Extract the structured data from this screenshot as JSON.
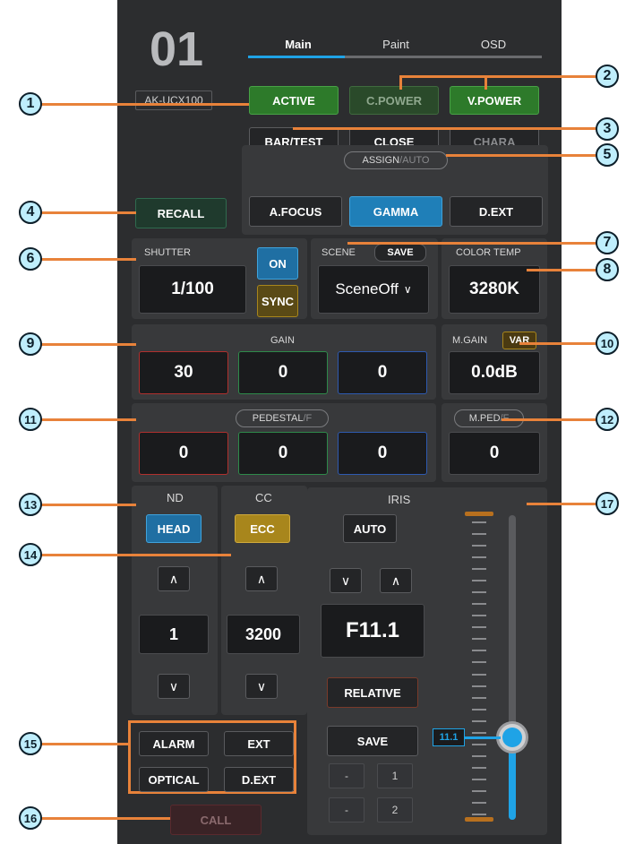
{
  "camera": {
    "number": "01",
    "model": "AK-UCX100"
  },
  "tabs": [
    {
      "label": "Main",
      "active": true
    },
    {
      "label": "Paint"
    },
    {
      "label": "OSD"
    }
  ],
  "top_buttons": {
    "active": "ACTIVE",
    "c_power": "C.POWER",
    "v_power": "V.POWER",
    "bar_test": "BAR/TEST",
    "close": "CLOSE",
    "chara": "CHARA"
  },
  "recall": "RECALL",
  "assign": {
    "label": "ASSIGN",
    "suffix": "/AUTO",
    "a_focus": "A.FOCUS",
    "gamma": "GAMMA",
    "d_ext": "D.EXT"
  },
  "shutter": {
    "label": "SHUTTER",
    "value": "1/100",
    "on": "ON",
    "sync": "SYNC"
  },
  "scene": {
    "label": "SCENE",
    "save": "SAVE",
    "value": "SceneOff"
  },
  "color_temp": {
    "label": "COLOR TEMP",
    "value": "3280K"
  },
  "gain": {
    "label": "GAIN",
    "r": "30",
    "g": "0",
    "b": "0"
  },
  "m_gain": {
    "label": "M.GAIN",
    "var": "VAR",
    "value": "0.0dB"
  },
  "pedestal": {
    "label": "PEDESTAL",
    "suffix": "/F",
    "r": "0",
    "g": "0",
    "b": "0"
  },
  "m_ped": {
    "label": "M.PED",
    "suffix": "/F",
    "value": "0"
  },
  "nd": {
    "label": "ND",
    "head": "HEAD",
    "value": "1"
  },
  "cc": {
    "label": "CC",
    "ecc": "ECC",
    "value": "3200"
  },
  "iris": {
    "label": "IRIS",
    "auto": "AUTO",
    "value": "F11.1",
    "relative": "RELATIVE",
    "save": "SAVE",
    "preset1_label": "-",
    "preset1": "1",
    "preset2_label": "-",
    "preset2": "2",
    "slider_value": "11.1",
    "slider_level": 0.27
  },
  "alarm": {
    "alarm": "ALARM",
    "ext": "EXT",
    "optical": "OPTICAL",
    "d_ext": "D.EXT"
  },
  "call": "CALL",
  "callouts": [
    "1",
    "2",
    "3",
    "4",
    "5",
    "6",
    "7",
    "8",
    "9",
    "10",
    "11",
    "12",
    "13",
    "14",
    "15",
    "16",
    "17"
  ],
  "colors": {
    "accent_blue": "#1fa3e6",
    "active_green": "#2d7a2a",
    "orange": "#e8823a",
    "ecc_gold": "#a8861c"
  }
}
